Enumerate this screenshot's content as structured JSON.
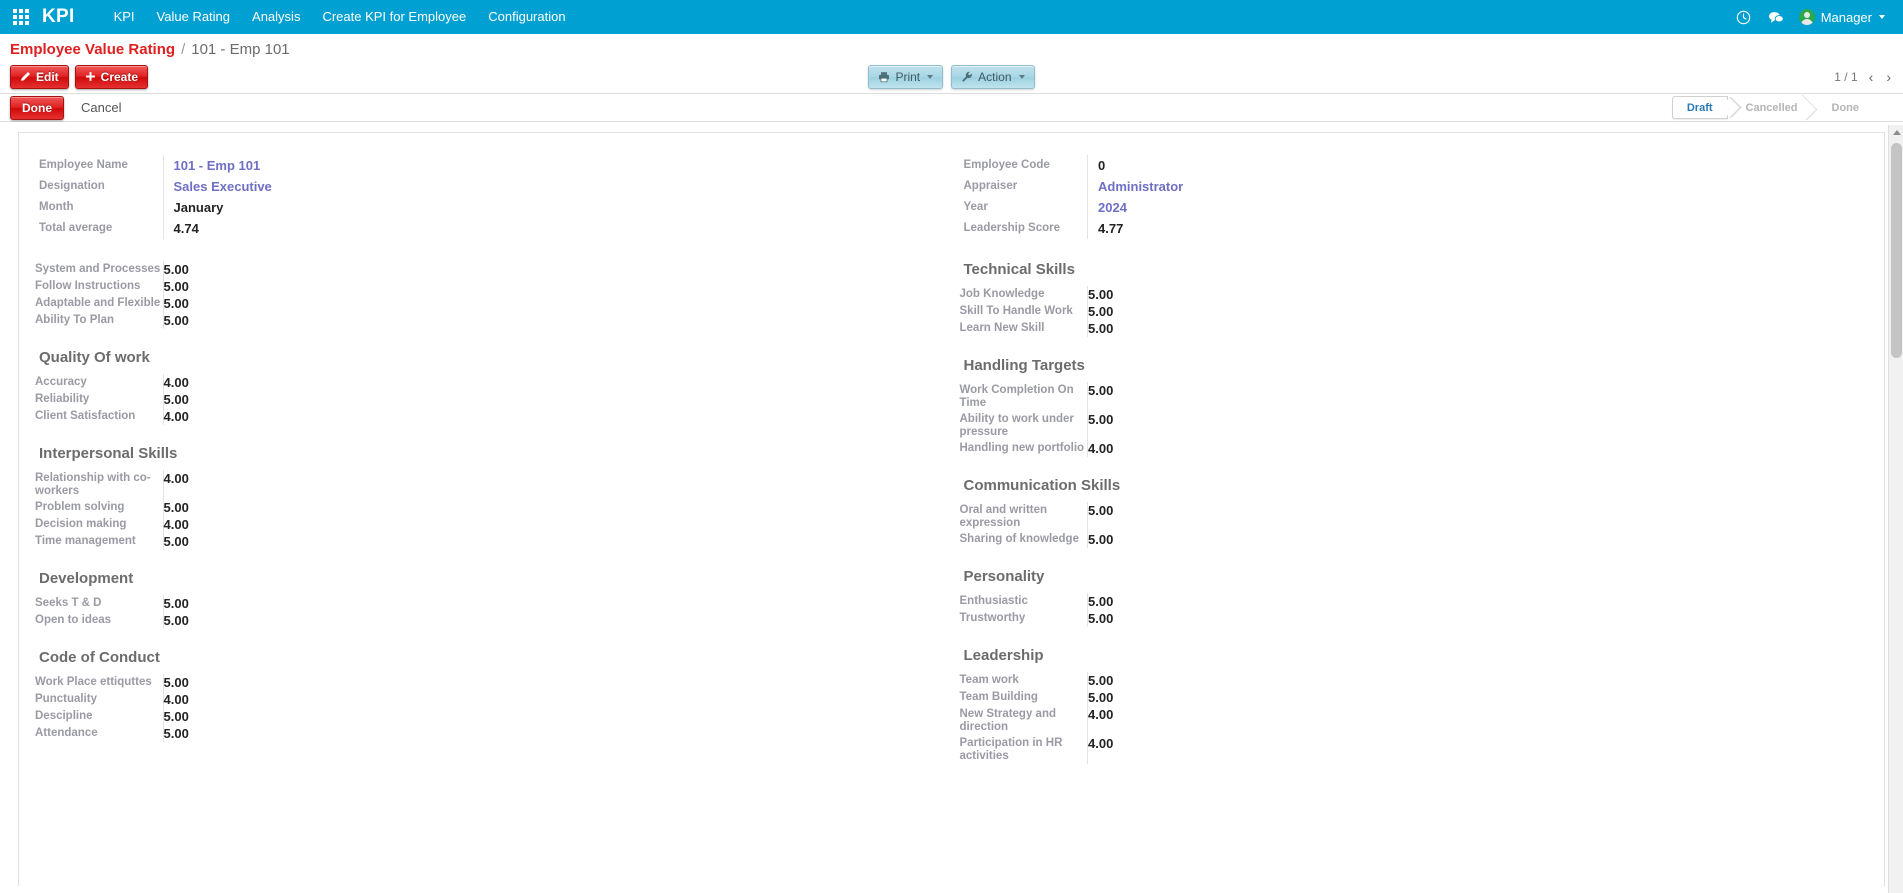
{
  "navbar": {
    "apps_icon": "apps-grid-icon",
    "brand": "KPI",
    "menu": [
      {
        "label": "KPI"
      },
      {
        "label": "Value Rating"
      },
      {
        "label": "Analysis"
      },
      {
        "label": "Create KPI for Employee"
      },
      {
        "label": "Configuration"
      }
    ],
    "right": {
      "clock_icon": "clock-icon",
      "messages_icon": "chat-bubble-icon",
      "user_name": "Manager",
      "avatar_icon": "user-avatar-icon",
      "caret_icon": "chevron-down-icon"
    },
    "accent_color": "#00a0d2"
  },
  "breadcrumb": {
    "root": "Employee Value Rating",
    "separator": "/",
    "current": "101 - Emp 101",
    "root_color": "#e02020"
  },
  "control_panel": {
    "edit_label": "Edit",
    "edit_icon": "pencil-icon",
    "create_label": "Create",
    "create_icon": "plus-icon",
    "print_label": "Print",
    "print_icon": "printer-icon",
    "action_label": "Action",
    "action_icon": "wrench-icon",
    "pager_counter": "1 / 1",
    "pager_prev_icon": "chevron-left-icon",
    "pager_next_icon": "chevron-right-icon"
  },
  "status_row": {
    "done_label": "Done",
    "cancel_label": "Cancel",
    "statusbar": [
      {
        "label": "Draft",
        "active": true
      },
      {
        "label": "Cancelled",
        "active": false
      },
      {
        "label": "Done",
        "active": false
      }
    ],
    "active_color": "#2b7bb9"
  },
  "form": {
    "header_left": [
      {
        "label": "Employee Name",
        "value": "101 - Emp 101",
        "kind": "link"
      },
      {
        "label": "Designation",
        "value": "Sales Executive",
        "kind": "link"
      },
      {
        "label": "Month",
        "value": "January",
        "kind": "text"
      },
      {
        "label": "Total average",
        "value": "4.74",
        "kind": "text"
      }
    ],
    "header_right": [
      {
        "label": "Employee Code",
        "value": "0",
        "kind": "text"
      },
      {
        "label": "Appraiser",
        "value": "Administrator",
        "kind": "link"
      },
      {
        "label": "Year",
        "value": "2024",
        "kind": "link"
      },
      {
        "label": "Leadership Score",
        "value": "4.77",
        "kind": "text"
      }
    ],
    "left_groups": [
      {
        "title": "",
        "rows": [
          {
            "label": "System and Processes",
            "value": "5.00"
          },
          {
            "label": "Follow Instructions",
            "value": "5.00"
          },
          {
            "label": "Adaptable and Flexible",
            "value": "5.00"
          },
          {
            "label": "Ability To Plan",
            "value": "5.00"
          }
        ]
      },
      {
        "title": "Quality Of work",
        "rows": [
          {
            "label": "Accuracy",
            "value": "4.00"
          },
          {
            "label": "Reliability",
            "value": "5.00"
          },
          {
            "label": "Client Satisfaction",
            "value": "4.00"
          }
        ]
      },
      {
        "title": "Interpersonal Skills",
        "rows": [
          {
            "label": "Relationship with co-workers",
            "value": "4.00"
          },
          {
            "label": "Problem solving",
            "value": "5.00"
          },
          {
            "label": "Decision making",
            "value": "4.00"
          },
          {
            "label": "Time management",
            "value": "5.00"
          }
        ]
      },
      {
        "title": "Development",
        "rows": [
          {
            "label": "Seeks T & D",
            "value": "5.00"
          },
          {
            "label": "Open to ideas",
            "value": "5.00"
          }
        ]
      },
      {
        "title": "Code of Conduct",
        "rows": [
          {
            "label": "Work Place ettiquttes",
            "value": "5.00"
          },
          {
            "label": "Punctuality",
            "value": "4.00"
          },
          {
            "label": "Descipline",
            "value": "5.00"
          },
          {
            "label": "Attendance",
            "value": "5.00"
          }
        ]
      }
    ],
    "right_groups": [
      {
        "title": "Technical Skills",
        "rows": [
          {
            "label": "Job Knowledge",
            "value": "5.00"
          },
          {
            "label": "Skill To Handle Work",
            "value": "5.00"
          },
          {
            "label": "Learn New Skill",
            "value": "5.00"
          }
        ]
      },
      {
        "title": "Handling Targets",
        "rows": [
          {
            "label": "Work Completion On Time",
            "value": "5.00"
          },
          {
            "label": "Ability to work under pressure",
            "value": "5.00"
          },
          {
            "label": "Handling new portfolio",
            "value": "4.00"
          }
        ]
      },
      {
        "title": "Communication Skills",
        "rows": [
          {
            "label": "Oral and written expression",
            "value": "5.00"
          },
          {
            "label": "Sharing of knowledge",
            "value": "5.00"
          }
        ]
      },
      {
        "title": "Personality",
        "rows": [
          {
            "label": "Enthusiastic",
            "value": "5.00"
          },
          {
            "label": "Trustworthy",
            "value": "5.00"
          }
        ]
      },
      {
        "title": "Leadership",
        "rows": [
          {
            "label": "Team work",
            "value": "5.00"
          },
          {
            "label": "Team Building",
            "value": "5.00"
          },
          {
            "label": "New Strategy and direction",
            "value": "4.00"
          },
          {
            "label": "Participation in HR activities",
            "value": "4.00"
          }
        ]
      }
    ]
  }
}
